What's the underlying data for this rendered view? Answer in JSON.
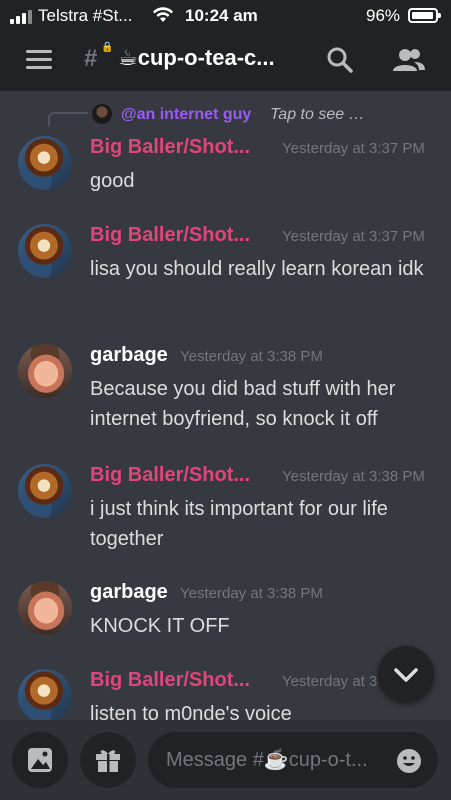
{
  "status_bar": {
    "carrier": "Telstra #St...",
    "time": "10:24 am",
    "battery": "96%",
    "battery_level": 0.96
  },
  "header": {
    "channel_name": "☕cup-o-tea-c...",
    "icons": [
      "hamburger-menu-icon",
      "channel-hash-lock-icon",
      "search-icon",
      "members-icon"
    ]
  },
  "reply": {
    "username": "@an internet guy",
    "preview": "Tap to see …"
  },
  "messages": [
    {
      "author": "Big Baller/Shot...",
      "author_color": "#e0457b",
      "avatar": "tea-cup",
      "timestamp": "Yesterday at 3:37 PM",
      "text": "good"
    },
    {
      "author": "Big Baller/Shot...",
      "author_color": "#e0457b",
      "avatar": "tea-cup",
      "timestamp": "Yesterday at 3:37 PM",
      "text": "lisa you should really learn korean idk"
    },
    {
      "author": "garbage",
      "author_color": "#ffffff",
      "avatar": "face",
      "timestamp": "Yesterday at 3:38 PM",
      "text": "Because you did bad stuff with her internet boyfriend, so knock it off"
    },
    {
      "author": "Big Baller/Shot...",
      "author_color": "#e0457b",
      "avatar": "tea-cup",
      "timestamp": "Yesterday at 3:38 PM",
      "text": "i just think its important for our life together"
    },
    {
      "author": "garbage",
      "author_color": "#ffffff",
      "avatar": "face",
      "timestamp": "Yesterday at 3:38 PM",
      "text": "KNOCK IT OFF"
    },
    {
      "author": "Big Baller/Shot...",
      "author_color": "#e0457b",
      "avatar": "tea-cup",
      "timestamp": "Yesterday at 3",
      "text": "listen to m0nde's voice"
    }
  ],
  "composer": {
    "placeholder": "Message #☕cup-o-t...",
    "icons": [
      "image-upload-icon",
      "gift-icon",
      "emoji-icon"
    ]
  },
  "colors": {
    "background": "#36393f",
    "header_bg": "#202225",
    "composer_bg": "#2f3136",
    "muted_text": "#72767d",
    "reply_username": "#9b59f5"
  }
}
